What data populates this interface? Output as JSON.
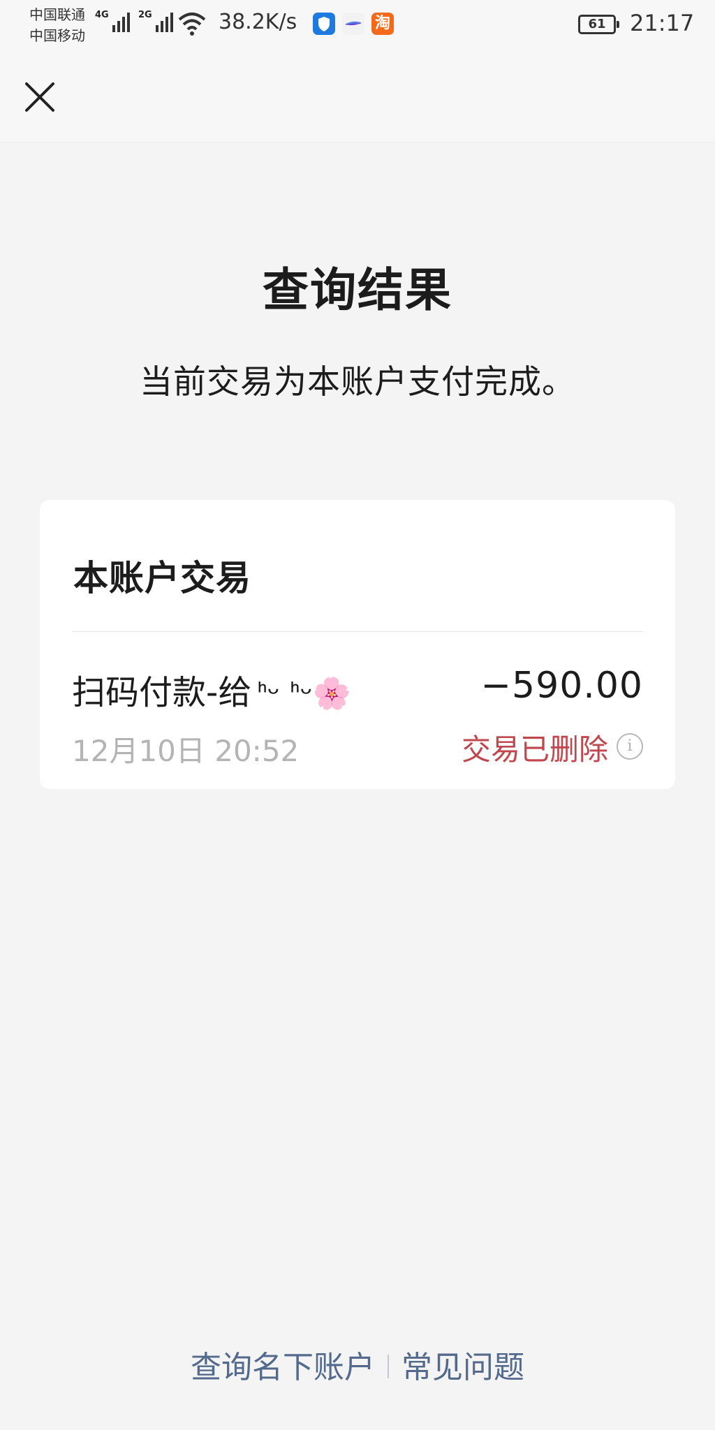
{
  "status_bar": {
    "carrier_1": "中国联通",
    "carrier_2": "中国移动",
    "network_1": "4G",
    "network_2": "2G",
    "speed": "38.2K/s",
    "battery": "61",
    "time": "21:17",
    "app_icons": [
      "shield-app-icon",
      "browser-app-icon",
      "taobao-app-icon"
    ],
    "taobao_glyph": "淘"
  },
  "header": {
    "close_icon": "close-icon"
  },
  "result": {
    "title": "查询结果",
    "message": "当前交易为本账户支付完成。"
  },
  "card": {
    "title": "本账户交易",
    "transaction": {
      "description": "扫码付款-给",
      "payee_nickname": "ᑋᵕ ᑋᵕ🌸",
      "amount": "−590.00",
      "datetime": "12月10日 20:52",
      "status": "交易已删除",
      "status_color": "#c0474d",
      "info_icon_glyph": "i"
    }
  },
  "footer": {
    "link_accounts": "查询名下账户",
    "link_faq": "常见问题",
    "link_color": "#546a8c"
  }
}
